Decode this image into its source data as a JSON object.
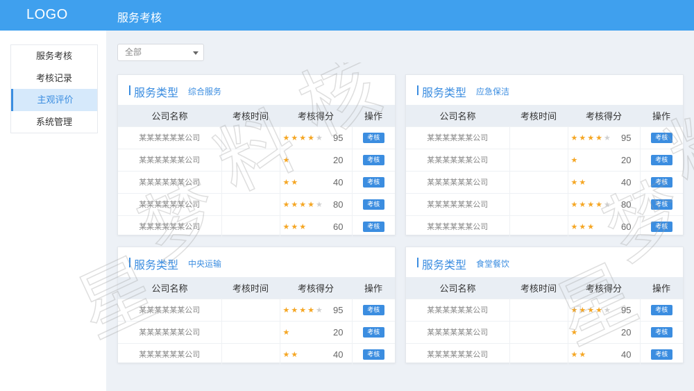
{
  "header": {
    "logo": "LOGO",
    "title": "服务考核"
  },
  "sidebar": {
    "items": [
      {
        "label": "服务考核",
        "active": false
      },
      {
        "label": "考核记录",
        "active": false
      },
      {
        "label": "主观评价",
        "active": true
      },
      {
        "label": "系统管理",
        "active": false
      }
    ]
  },
  "filter": {
    "selected": "全部"
  },
  "columns": {
    "company": "公司名称",
    "time": "考核时间",
    "score": "考核得分",
    "action": "操作"
  },
  "cards": [
    {
      "type_label": "服务类型",
      "type_value": "综合服务",
      "rows": [
        {
          "company": "某某某某某某公司",
          "time": "",
          "stars": 4,
          "score": 95,
          "action": "考核"
        },
        {
          "company": "某某某某某某公司",
          "time": "",
          "stars": 1,
          "score": 20,
          "action": "考核"
        },
        {
          "company": "某某某某某某公司",
          "time": "",
          "stars": 2,
          "score": 40,
          "action": "考核"
        },
        {
          "company": "某某某某某某公司",
          "time": "",
          "stars": 4,
          "score": 80,
          "action": "考核"
        },
        {
          "company": "某某某某某某公司",
          "time": "",
          "stars": 3,
          "score": 60,
          "action": "考核"
        }
      ]
    },
    {
      "type_label": "服务类型",
      "type_value": "应急保洁",
      "rows": [
        {
          "company": "某某某某某某公司",
          "time": "",
          "stars": 4,
          "score": 95,
          "action": "考核"
        },
        {
          "company": "某某某某某某公司",
          "time": "",
          "stars": 1,
          "score": 20,
          "action": "考核"
        },
        {
          "company": "某某某某某某公司",
          "time": "",
          "stars": 2,
          "score": 40,
          "action": "考核"
        },
        {
          "company": "某某某某某某公司",
          "time": "",
          "stars": 4,
          "score": 80,
          "action": "考核"
        },
        {
          "company": "某某某某某某公司",
          "time": "",
          "stars": 3,
          "score": 60,
          "action": "考核"
        }
      ]
    },
    {
      "type_label": "服务类型",
      "type_value": "中央运输",
      "rows": [
        {
          "company": "某某某某某某公司",
          "time": "",
          "stars": 4,
          "score": 95,
          "action": "考核"
        },
        {
          "company": "某某某某某某公司",
          "time": "",
          "stars": 1,
          "score": 20,
          "action": "考核"
        },
        {
          "company": "某某某某某某公司",
          "time": "",
          "stars": 2,
          "score": 40,
          "action": "考核"
        }
      ]
    },
    {
      "type_label": "服务类型",
      "type_value": "食堂餐饮",
      "rows": [
        {
          "company": "某某某某某某公司",
          "time": "",
          "stars": 4,
          "score": 95,
          "action": "考核"
        },
        {
          "company": "某某某某某某公司",
          "time": "",
          "stars": 1,
          "score": 20,
          "action": "考核"
        },
        {
          "company": "某某某某某某公司",
          "time": "",
          "stars": 2,
          "score": 40,
          "action": "考核"
        }
      ]
    }
  ],
  "colors": {
    "header_bg": "#3fa0ee",
    "accent": "#3b8de0",
    "star": "#f5a623",
    "star_empty": "#d0d0d0"
  },
  "watermark": {
    "chars": [
      "星",
      "梦",
      "料",
      "核",
      "星",
      "梦",
      "料"
    ]
  }
}
